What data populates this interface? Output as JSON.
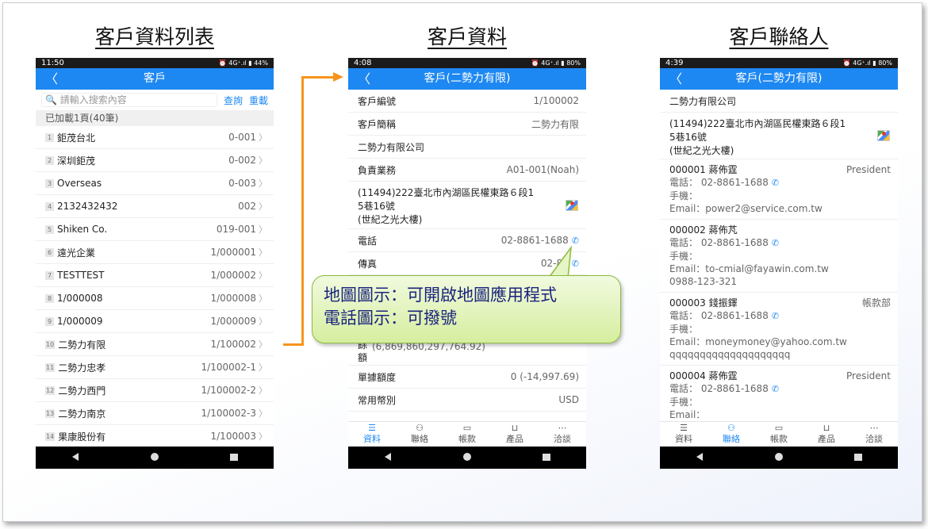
{
  "titles": {
    "list": "客戶資料列表",
    "detail": "客戶資料",
    "contacts": "客戶聯絡人"
  },
  "phone1": {
    "status": {
      "time": "11:50",
      "right": "⏰ 4G⁺.ıl ▮ 44%"
    },
    "appbar": {
      "back": "〈",
      "title": "客戶"
    },
    "search": {
      "placeholder": "🔍 請輸入搜索內容",
      "query": "查詢",
      "reset": "重載"
    },
    "loaded": "已加載1頁(40筆)",
    "rows": [
      {
        "idx": "1",
        "name": "鉅茂台北",
        "code": "0-001"
      },
      {
        "idx": "2",
        "name": "深圳鉅茂",
        "code": "0-002"
      },
      {
        "idx": "3",
        "name": "Overseas",
        "code": "0-003"
      },
      {
        "idx": "4",
        "name": "2132432432",
        "code": "002"
      },
      {
        "idx": "5",
        "name": "Shiken Co.",
        "code": "019-001"
      },
      {
        "idx": "6",
        "name": "遠光企業",
        "code": "1/000001"
      },
      {
        "idx": "7",
        "name": "TESTTEST",
        "code": "1/000002"
      },
      {
        "idx": "8",
        "name": "1/000008",
        "code": "1/000008"
      },
      {
        "idx": "9",
        "name": "1/000009",
        "code": "1/000009"
      },
      {
        "idx": "10",
        "name": "二勢力有限",
        "code": "1/100002"
      },
      {
        "idx": "11",
        "name": "二勢力忠孝",
        "code": "1/100002-1"
      },
      {
        "idx": "12",
        "name": "二勢力西門",
        "code": "1/100002-2"
      },
      {
        "idx": "13",
        "name": "二勢力南京",
        "code": "1/100002-3"
      },
      {
        "idx": "14",
        "name": "果康股份有",
        "code": "1/100003"
      }
    ]
  },
  "phone2": {
    "status": {
      "time": "4:08",
      "right": "⏰ 4G⁺.ıl ▮ 80%"
    },
    "appbar": {
      "back": "〈",
      "title": "客戶(二勢力有限)"
    },
    "code_label": "客戶編號",
    "code_value": "1/100002",
    "short_label": "客戶簡稱",
    "short_value": "二勢力有限",
    "company": "二勢力有限公司",
    "sales_label": "負責業務",
    "sales_value": "A01-001(Noah)",
    "address": [
      "(11494)222臺北市內湖區民權東路６段1",
      "5巷16號",
      "(世紀之光大樓)"
    ],
    "tel_label": "電話",
    "tel_value": "02-8861-1688",
    "fax_label": "傳真",
    "fax_value": "02-88",
    "credit_label": [
      "額",
      "餘",
      "額"
    ],
    "credit_value": "9,999,000,000,000 (6,869,860,297,764.92)",
    "bill_label": "單據額度",
    "bill_value": "0 (-14,997.69)",
    "currency_label": "常用幣別",
    "currency_value": "USD"
  },
  "phone3": {
    "status": {
      "time": "4:39",
      "right": "⏰ 4G⁺.ıl ▮ 80%"
    },
    "appbar": {
      "back": "〈",
      "title": "客戶(二勢力有限)"
    },
    "company": "二勢力有限公司",
    "address": [
      "(11494)222臺北市內湖區民權東路６段1",
      "5巷16號",
      "(世紀之光大樓)"
    ],
    "contacts": [
      {
        "head": "000001 蔣佈霆",
        "role": "President",
        "tel": "電話： 02-8861-1688",
        "mobile": "手機：",
        "email": "Email：power2@service.com.tw",
        "extra": ""
      },
      {
        "head": "000002 蔣佈芃",
        "role": "",
        "tel": "電話： 02-8861-1688",
        "mobile": "手機：",
        "email": "Email：to-cmial@fayawin.com.tw",
        "extra": "0988-123-321"
      },
      {
        "head": "000003 錢振鐸",
        "role": "帳款部",
        "tel": "電話： 02-8861-1688",
        "mobile": "手機：",
        "email": "Email：moneymoney@yahoo.com.tw",
        "extra": "qqqqqqqqqqqqqqqqqqqq"
      },
      {
        "head": "000004 蔣佈霆",
        "role": "President",
        "tel": "電話： 02-8861-1688",
        "mobile": "手機：",
        "email": "Email：",
        "extra": ""
      }
    ]
  },
  "tabs": [
    "資料",
    "聯絡",
    "帳款",
    "產品",
    "洽談"
  ],
  "callout": {
    "line1": "地圖圖示：可開啟地圖應用程式",
    "line2": "電話圖示：可撥號"
  },
  "colors": {
    "accent": "#1e88f2",
    "arrow": "#f7941d",
    "callout_border": "#8dbb3c"
  }
}
